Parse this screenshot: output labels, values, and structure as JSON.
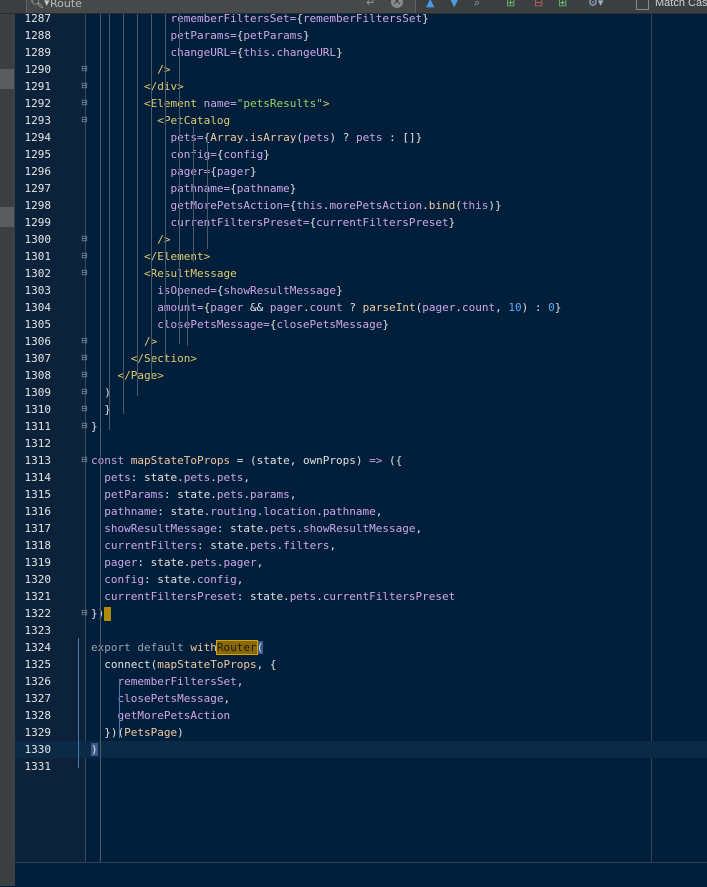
{
  "findbar": {
    "query": "Route",
    "match_case_label": "Match Cas",
    "icons": [
      "search-icon",
      "clear-icon",
      "arrow-up-icon",
      "arrow-down-icon",
      "find-in-selection-icon",
      "select-all-occurrences-icon",
      "add-occurrence-icon",
      "remove-occurrence-icon",
      "settings-icon"
    ]
  },
  "editor": {
    "current_line": "1330",
    "lines": [
      {
        "n": "1287",
        "code": [
          [
            "tk-attr",
            "            rememberFiltersSet="
          ],
          [
            "tk-plain",
            "{"
          ],
          [
            "tk-attr",
            "rememberFiltersSet"
          ],
          [
            "tk-plain",
            "}"
          ]
        ]
      },
      {
        "n": "1288",
        "code": [
          [
            "tk-attr",
            "            petParams="
          ],
          [
            "tk-plain",
            "{"
          ],
          [
            "tk-attr",
            "petParams"
          ],
          [
            "tk-plain",
            "}"
          ]
        ]
      },
      {
        "n": "1289",
        "code": [
          [
            "tk-attr",
            "            changeURL="
          ],
          [
            "tk-plain",
            "{"
          ],
          [
            "tk-kw2",
            "this"
          ],
          [
            "tk-plain",
            "."
          ],
          [
            "tk-attr",
            "changeURL"
          ],
          [
            "tk-plain",
            "}"
          ]
        ]
      },
      {
        "n": "1290",
        "code": [
          [
            "tk-tag",
            "          />"
          ]
        ]
      },
      {
        "n": "1291",
        "code": [
          [
            "tk-tag",
            "        </div>"
          ]
        ]
      },
      {
        "n": "1292",
        "code": [
          [
            "tk-tag",
            "        <Element "
          ],
          [
            "tk-attr",
            "name="
          ],
          [
            "tk-str",
            "\"petsResults\""
          ],
          [
            "tk-tag",
            ">"
          ]
        ]
      },
      {
        "n": "1293",
        "code": [
          [
            "tk-tag",
            "          <PetCatalog"
          ]
        ]
      },
      {
        "n": "1294",
        "code": [
          [
            "tk-attr",
            "            pets="
          ],
          [
            "tk-plain",
            "{"
          ],
          [
            "tk-fn",
            "Array"
          ],
          [
            "tk-plain",
            "."
          ],
          [
            "tk-fn",
            "isArray"
          ],
          [
            "tk-plain",
            "("
          ],
          [
            "tk-attr",
            "pets"
          ],
          [
            "tk-plain",
            ") ? "
          ],
          [
            "tk-attr",
            "pets"
          ],
          [
            "tk-plain",
            " : []}"
          ]
        ]
      },
      {
        "n": "1295",
        "code": [
          [
            "tk-attr",
            "            config="
          ],
          [
            "tk-plain",
            "{"
          ],
          [
            "tk-attr",
            "config"
          ],
          [
            "tk-plain",
            "}"
          ]
        ]
      },
      {
        "n": "1296",
        "code": [
          [
            "tk-attr",
            "            pager="
          ],
          [
            "tk-plain",
            "{"
          ],
          [
            "tk-attr",
            "pager"
          ],
          [
            "tk-plain",
            "}"
          ]
        ]
      },
      {
        "n": "1297",
        "code": [
          [
            "tk-attr",
            "            pathname="
          ],
          [
            "tk-plain",
            "{"
          ],
          [
            "tk-attr",
            "pathname"
          ],
          [
            "tk-plain",
            "}"
          ]
        ]
      },
      {
        "n": "1298",
        "code": [
          [
            "tk-attr",
            "            getMorePetsAction="
          ],
          [
            "tk-plain",
            "{"
          ],
          [
            "tk-kw2",
            "this"
          ],
          [
            "tk-plain",
            "."
          ],
          [
            "tk-attr",
            "morePetsAction"
          ],
          [
            "tk-plain",
            "."
          ],
          [
            "tk-fn",
            "bind"
          ],
          [
            "tk-plain",
            "("
          ],
          [
            "tk-kw2",
            "this"
          ],
          [
            "tk-plain",
            ")}"
          ]
        ]
      },
      {
        "n": "1299",
        "code": [
          [
            "tk-attr",
            "            currentFiltersPreset="
          ],
          [
            "tk-plain",
            "{"
          ],
          [
            "tk-attr",
            "currentFiltersPreset"
          ],
          [
            "tk-plain",
            "}"
          ]
        ]
      },
      {
        "n": "1300",
        "code": [
          [
            "tk-tag",
            "          />"
          ]
        ]
      },
      {
        "n": "1301",
        "code": [
          [
            "tk-tag",
            "        </Element>"
          ]
        ]
      },
      {
        "n": "1302",
        "code": [
          [
            "tk-tag",
            "        <ResultMessage"
          ]
        ]
      },
      {
        "n": "1303",
        "code": [
          [
            "tk-attr",
            "          isOpened="
          ],
          [
            "tk-plain",
            "{"
          ],
          [
            "tk-attr",
            "showResultMessage"
          ],
          [
            "tk-plain",
            "}"
          ]
        ]
      },
      {
        "n": "1304",
        "code": [
          [
            "tk-attr",
            "          amount="
          ],
          [
            "tk-plain",
            "{"
          ],
          [
            "tk-attr",
            "pager"
          ],
          [
            "tk-plain",
            " && "
          ],
          [
            "tk-attr",
            "pager"
          ],
          [
            "tk-plain",
            "."
          ],
          [
            "tk-attr",
            "count"
          ],
          [
            "tk-plain",
            " ? "
          ],
          [
            "tk-fn",
            "parseInt"
          ],
          [
            "tk-plain",
            "("
          ],
          [
            "tk-attr",
            "pager"
          ],
          [
            "tk-plain",
            "."
          ],
          [
            "tk-attr",
            "count"
          ],
          [
            "tk-plain",
            ", "
          ],
          [
            "tk-num",
            "10"
          ],
          [
            "tk-plain",
            ") : "
          ],
          [
            "tk-num",
            "0"
          ],
          [
            "tk-plain",
            "}"
          ]
        ]
      },
      {
        "n": "1305",
        "code": [
          [
            "tk-attr",
            "          closePetsMessage="
          ],
          [
            "tk-plain",
            "{"
          ],
          [
            "tk-attr",
            "closePetsMessage"
          ],
          [
            "tk-plain",
            "}"
          ]
        ]
      },
      {
        "n": "1306",
        "code": [
          [
            "tk-tag",
            "        />"
          ]
        ]
      },
      {
        "n": "1307",
        "code": [
          [
            "tk-tag",
            "      </Section>"
          ]
        ]
      },
      {
        "n": "1308",
        "code": [
          [
            "tk-tag",
            "    </Page>"
          ]
        ]
      },
      {
        "n": "1309",
        "code": [
          [
            "tk-plain",
            "  )"
          ]
        ]
      },
      {
        "n": "1310",
        "code": [
          [
            "tk-plain",
            "  }"
          ]
        ]
      },
      {
        "n": "1311",
        "code": [
          [
            "tk-plain",
            "}"
          ]
        ]
      },
      {
        "n": "1312",
        "code": [
          [
            "tk-plain",
            ""
          ]
        ]
      },
      {
        "n": "1313",
        "code": [
          [
            "tk-kw2",
            "const "
          ],
          [
            "tk-fn",
            "mapStateToProps"
          ],
          [
            "tk-plain",
            " = (state, ownProps) "
          ],
          [
            "tk-kw2",
            "=>"
          ],
          [
            "tk-plain",
            " ({"
          ]
        ]
      },
      {
        "n": "1314",
        "code": [
          [
            "tk-prop",
            "  pets"
          ],
          [
            "tk-plain",
            ": state."
          ],
          [
            "tk-prop",
            "pets"
          ],
          [
            "tk-plain",
            "."
          ],
          [
            "tk-prop",
            "pets"
          ],
          [
            "tk-plain",
            ","
          ]
        ]
      },
      {
        "n": "1315",
        "code": [
          [
            "tk-prop",
            "  petParams"
          ],
          [
            "tk-plain",
            ": state."
          ],
          [
            "tk-prop",
            "pets"
          ],
          [
            "tk-plain",
            "."
          ],
          [
            "tk-prop",
            "params"
          ],
          [
            "tk-plain",
            ","
          ]
        ]
      },
      {
        "n": "1316",
        "code": [
          [
            "tk-prop",
            "  pathname"
          ],
          [
            "tk-plain",
            ": state."
          ],
          [
            "tk-prop",
            "routing"
          ],
          [
            "tk-plain",
            "."
          ],
          [
            "tk-prop",
            "location"
          ],
          [
            "tk-plain",
            "."
          ],
          [
            "tk-prop",
            "pathname"
          ],
          [
            "tk-plain",
            ","
          ]
        ]
      },
      {
        "n": "1317",
        "code": [
          [
            "tk-prop",
            "  showResultMessage"
          ],
          [
            "tk-plain",
            ": state."
          ],
          [
            "tk-prop",
            "pets"
          ],
          [
            "tk-plain",
            "."
          ],
          [
            "tk-prop",
            "showResultMessage"
          ],
          [
            "tk-plain",
            ","
          ]
        ]
      },
      {
        "n": "1318",
        "code": [
          [
            "tk-prop",
            "  currentFilters"
          ],
          [
            "tk-plain",
            ": state."
          ],
          [
            "tk-prop",
            "pets"
          ],
          [
            "tk-plain",
            "."
          ],
          [
            "tk-prop",
            "filters"
          ],
          [
            "tk-plain",
            ","
          ]
        ]
      },
      {
        "n": "1319",
        "code": [
          [
            "tk-prop",
            "  pager"
          ],
          [
            "tk-plain",
            ": state."
          ],
          [
            "tk-prop",
            "pets"
          ],
          [
            "tk-plain",
            "."
          ],
          [
            "tk-prop",
            "pager"
          ],
          [
            "tk-plain",
            ","
          ]
        ]
      },
      {
        "n": "1320",
        "code": [
          [
            "tk-prop",
            "  config"
          ],
          [
            "tk-plain",
            ": state."
          ],
          [
            "tk-prop",
            "config"
          ],
          [
            "tk-plain",
            ","
          ]
        ]
      },
      {
        "n": "1321",
        "code": [
          [
            "tk-prop",
            "  currentFiltersPreset"
          ],
          [
            "tk-plain",
            ": state."
          ],
          [
            "tk-prop",
            "pets"
          ],
          [
            "tk-plain",
            "."
          ],
          [
            "tk-prop",
            "currentFiltersPreset"
          ]
        ]
      },
      {
        "n": "1322",
        "code": [
          [
            "tk-plain",
            "})"
          ],
          [
            "caret",
            ""
          ]
        ]
      },
      {
        "n": "1323",
        "code": [
          [
            "tk-plain",
            ""
          ]
        ]
      },
      {
        "n": "1324",
        "code": [
          [
            "tk-muted",
            "export default "
          ],
          [
            "tk-fn",
            "with"
          ],
          [
            "tk-hl",
            "Router"
          ],
          [
            "tk-brace",
            "("
          ]
        ]
      },
      {
        "n": "1325",
        "code": [
          [
            "tk-plain",
            "  connect("
          ],
          [
            "tk-fn",
            "mapStateToProps"
          ],
          [
            "tk-plain",
            ", {"
          ]
        ]
      },
      {
        "n": "1326",
        "code": [
          [
            "tk-prop",
            "    rememberFiltersSet"
          ],
          [
            "tk-plain",
            ","
          ]
        ]
      },
      {
        "n": "1327",
        "code": [
          [
            "tk-prop",
            "    closePetsMessage"
          ],
          [
            "tk-plain",
            ","
          ]
        ]
      },
      {
        "n": "1328",
        "code": [
          [
            "tk-prop",
            "    getMorePetsAction"
          ]
        ]
      },
      {
        "n": "1329",
        "code": [
          [
            "tk-plain",
            "  })("
          ],
          [
            "tk-fn",
            "PetsPage"
          ],
          [
            "tk-plain",
            ")"
          ]
        ]
      },
      {
        "n": "1330",
        "code": [
          [
            "tk-brace",
            ")"
          ]
        ]
      },
      {
        "n": "1331",
        "code": [
          [
            "tk-plain",
            ""
          ]
        ]
      }
    ],
    "fold_lines": [
      "1290",
      "1291",
      "1292",
      "1293",
      "1300",
      "1301",
      "1302",
      "1306",
      "1307",
      "1308",
      "1309",
      "1310",
      "1311",
      "1313",
      "1322"
    ]
  }
}
